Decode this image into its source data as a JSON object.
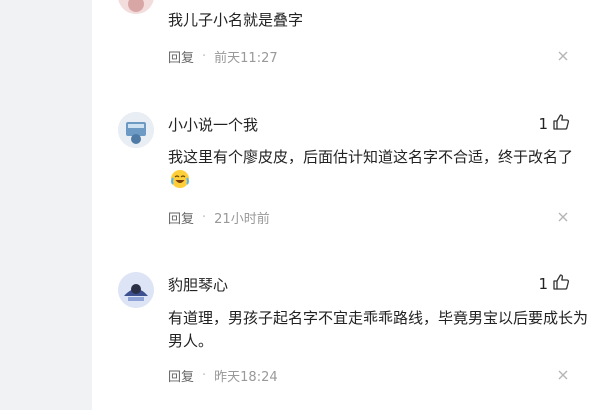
{
  "comments": [
    {
      "text": "我儿子小名就是叠字",
      "reply_label": "回复",
      "separator": "·",
      "time": "前天11:27"
    },
    {
      "username": "小小说一个我",
      "likes": "1",
      "text": "我这里有个廖皮皮，后面估计知道这名字不合适，终于改名了",
      "reply_label": "回复",
      "separator": "·",
      "time": "21小时前"
    },
    {
      "username": "豹胆琴心",
      "likes": "1",
      "text": "有道理，男孩子起名字不宜走乖乖路线，毕竟男宝以后要成长为男人。",
      "reply_label": "回复",
      "separator": "·",
      "time": "昨天18:24"
    }
  ],
  "icons": {
    "like": "thumbs-up-icon",
    "close": "close-icon",
    "emoji": "laughing-crying-emoji"
  },
  "colors": {
    "meta_text": "#999999",
    "background": "#f1f2f3",
    "panel": "#ffffff"
  }
}
